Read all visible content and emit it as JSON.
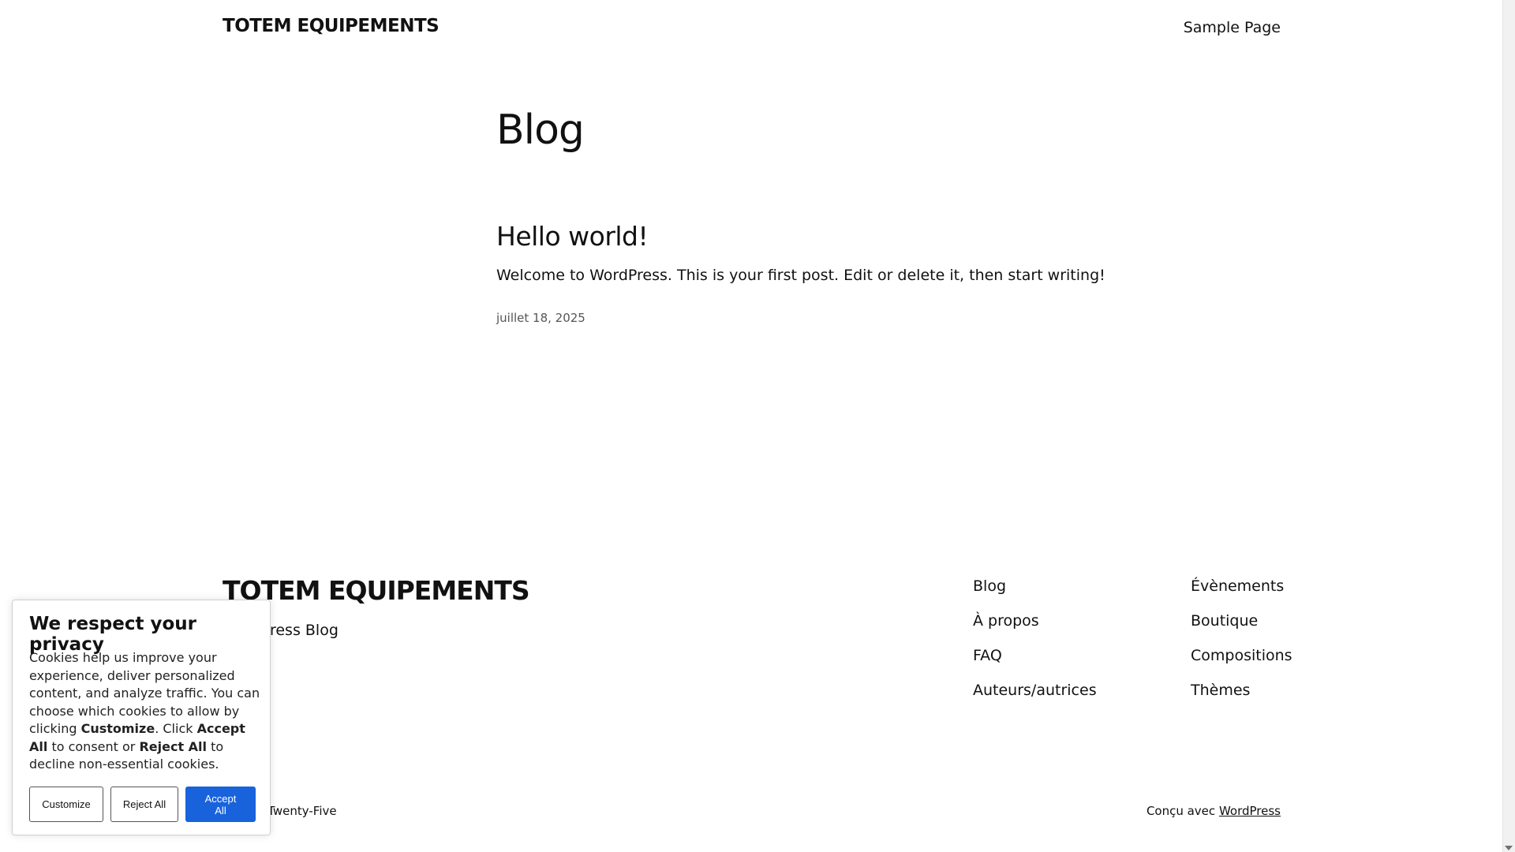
{
  "header": {
    "site_title": "TOTEM EQUIPEMENTS",
    "nav_link": "Sample Page"
  },
  "main": {
    "page_title": "Blog",
    "post": {
      "title": "Hello world!",
      "excerpt": "Welcome to WordPress. This is your first post. Edit or delete it, then start writing!",
      "date": "juillet 18, 2025"
    }
  },
  "footer": {
    "site_title": "TOTEM EQUIPEMENTS",
    "tagline": "WordPress Blog",
    "nav_col1": [
      "Blog",
      "À propos",
      "FAQ",
      "Auteurs/autrices"
    ],
    "nav_col2": [
      "Évènements",
      "Boutique",
      "Compositions",
      "Thèmes"
    ],
    "theme_credit": "Twenty Twenty-Five",
    "credit_prefix": "Conçu avec",
    "credit_link": "WordPress"
  },
  "cookie_banner": {
    "title": "We respect your privacy",
    "text_1": "Cookies help us improve your experience, deliver personalized content, and analyze traffic. You can choose which cookies to allow by clicking ",
    "text_bold_1": "Customize",
    "text_2": ". Click ",
    "text_bold_2": "Accept All",
    "text_3": " to consent or ",
    "text_bold_3": "Reject All",
    "text_4": " to decline non-essential cookies.",
    "customize_label": "Customize",
    "reject_label": "Reject All",
    "accept_label": "Accept All",
    "accent_color": "#1863dc"
  }
}
